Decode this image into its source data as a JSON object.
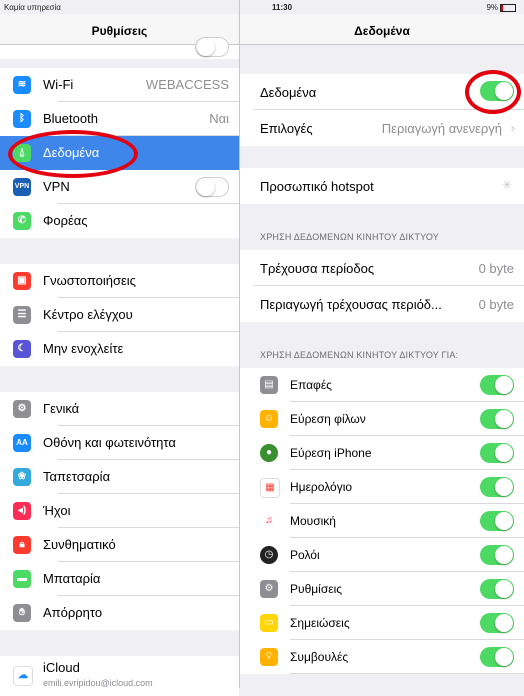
{
  "status": {
    "carrier": "Καμία υπηρεσία",
    "time": "11:30",
    "battery": "9%"
  },
  "left": {
    "title": "Ρυθμίσεις",
    "items": [
      {
        "label": "Wi-Fi",
        "value": "WEBACCESS",
        "icon": "wifi-icon",
        "color": "#1a8cff"
      },
      {
        "label": "Bluetooth",
        "value": "Ναι",
        "icon": "bluetooth-icon",
        "color": "#1a8cff"
      },
      {
        "label": "Δεδομένα",
        "value": "",
        "icon": "cellular-icon",
        "color": "#4cd964"
      },
      {
        "label": "VPN",
        "value": "",
        "icon": "vpn-icon",
        "color": "#1a5fb4"
      },
      {
        "label": "Φορέας",
        "value": "",
        "icon": "phone-icon",
        "color": "#4cd964"
      },
      {
        "label": "Γνωστοποιήσεις",
        "value": "",
        "icon": "notifications-icon",
        "color": "#ff3b30"
      },
      {
        "label": "Κέντρο ελέγχου",
        "value": "",
        "icon": "control-center-icon",
        "color": "#8e8e93"
      },
      {
        "label": "Μην ενοχλείτε",
        "value": "",
        "icon": "moon-icon",
        "color": "#5856d6"
      },
      {
        "label": "Γενικά",
        "value": "",
        "icon": "gear-icon",
        "color": "#8e8e93"
      },
      {
        "label": "Οθόνη και φωτεινότητα",
        "value": "",
        "icon": "display-icon",
        "color": "#1a8cff"
      },
      {
        "label": "Ταπετσαρία",
        "value": "",
        "icon": "wallpaper-icon",
        "color": "#34aadc"
      },
      {
        "label": "Ήχοι",
        "value": "",
        "icon": "sound-icon",
        "color": "#ff2d55"
      },
      {
        "label": "Συνθηματικό",
        "value": "",
        "icon": "lock-icon",
        "color": "#ff3b30"
      },
      {
        "label": "Μπαταρία",
        "value": "",
        "icon": "battery-icon",
        "color": "#4cd964"
      },
      {
        "label": "Απόρρητο",
        "value": "",
        "icon": "hand-icon",
        "color": "#8e8e93"
      },
      {
        "label": "iCloud",
        "value": "",
        "icon": "cloud-icon",
        "color": "#ffffff"
      }
    ],
    "icloud_email": "emili.evripidou@icloud.com"
  },
  "right": {
    "title": "Δεδομένα",
    "data_label": "Δεδομένα",
    "options_label": "Επιλογές",
    "options_value": "Περιαγωγή ανενεργή",
    "hotspot_label": "Προσωπικό hotspot",
    "usage_header": "ΧΡΗΣΗ ΔΕΔΟΜΕΝΩΝ ΚΙΝΗΤΟΥ ΔΙΚΤΥΟΥ",
    "current_period_label": "Τρέχουσα περίοδος",
    "current_period_value": "0 byte",
    "roaming_period_label": "Περιαγωγή τρέχουσας περιόδ...",
    "roaming_period_value": "0 byte",
    "apps_header": "ΧΡΗΣΗ ΔΕΔΟΜΕΝΩΝ ΚΙΝΗΤΟΥ ΔΙΚΤΥΟΥ ΓΙΑ:",
    "apps": [
      {
        "label": "Επαφές",
        "icon": "contacts-icon",
        "color": "#8e8e93",
        "on": true
      },
      {
        "label": "Εύρεση φίλων",
        "icon": "find-friends-icon",
        "color": "#ffb300",
        "on": true
      },
      {
        "label": "Εύρεση iPhone",
        "icon": "find-iphone-icon",
        "color": "#3a8f2f",
        "on": true
      },
      {
        "label": "Ημερολόγιο",
        "icon": "calendar-icon",
        "color": "#ffffff",
        "on": true
      },
      {
        "label": "Μουσική",
        "icon": "music-icon",
        "color": "#ffffff",
        "on": true
      },
      {
        "label": "Ρολόι",
        "icon": "clock-icon",
        "color": "#222222",
        "on": true
      },
      {
        "label": "Ρυθμίσεις",
        "icon": "settings-icon",
        "color": "#8e8e93",
        "on": true
      },
      {
        "label": "Σημειώσεις",
        "icon": "notes-icon",
        "color": "#ffd60a",
        "on": true
      },
      {
        "label": "Συμβουλές",
        "icon": "tips-icon",
        "color": "#ffb300",
        "on": true
      }
    ]
  }
}
